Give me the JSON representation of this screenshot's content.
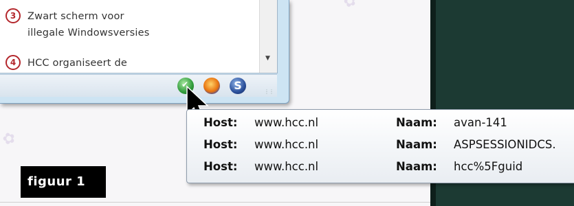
{
  "news_items": [
    {
      "number": "3",
      "lines": [
        "Zwart scherm voor",
        "illegale Windowsversies"
      ]
    },
    {
      "number": "4",
      "lines": [
        "HCC organiseert de"
      ]
    }
  ],
  "tray": {
    "icons": [
      "green-check-icon",
      "firefox-icon",
      "s-shield-icon"
    ],
    "s_glyph": "S"
  },
  "tooltip": {
    "rows": [
      {
        "host_label": "Host:",
        "host_value": "www.hcc.nl",
        "naam_label": "Naam:",
        "naam_value": "avan-141"
      },
      {
        "host_label": "Host:",
        "host_value": "www.hcc.nl",
        "naam_label": "Naam:",
        "naam_value": "ASPSESSIONIDCS."
      },
      {
        "host_label": "Host:",
        "host_value": "www.hcc.nl",
        "naam_label": "Naam:",
        "naam_value": "hcc%5Fguid"
      }
    ]
  },
  "figure_label": "figuur 1",
  "colors": {
    "badge_red": "#b3262b",
    "dark_panel": "#1c3a33",
    "window_frame": "#cde4f3"
  }
}
